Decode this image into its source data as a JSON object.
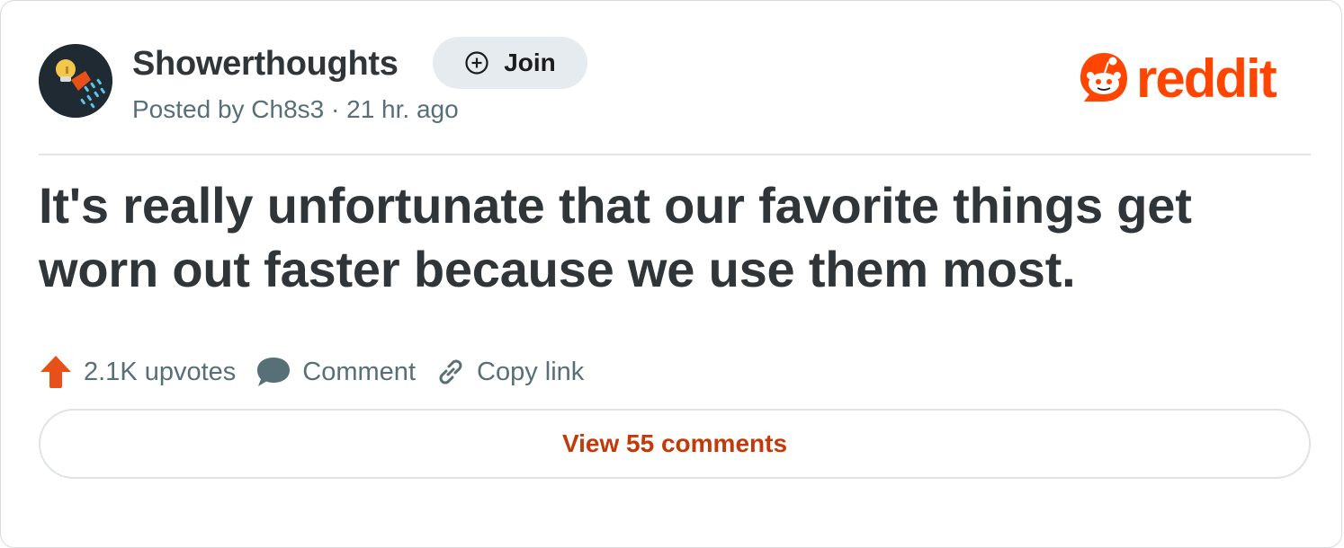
{
  "post": {
    "subreddit": "Showerthoughts",
    "join_label": "Join",
    "meta": "Posted by Ch8s3 · 21 hr. ago",
    "title": "It's really unfortunate that our favorite things get worn out faster because we use them most."
  },
  "brand": {
    "wordmark": "reddit",
    "color": "#ff4500"
  },
  "actions": {
    "upvotes_label": "2.1K upvotes",
    "comment_label": "Comment",
    "copy_link_label": "Copy link"
  },
  "view_comments_label": "View 55 comments",
  "colors": {
    "upvote": "#e8501a",
    "link_text": "#c33a09",
    "avatar_bg": "#1f2a33"
  },
  "icons": [
    "subreddit-avatar-icon",
    "plus-circle-icon",
    "reddit-snoo-icon",
    "upvote-arrow-icon",
    "comment-bubble-icon",
    "link-chain-icon"
  ]
}
